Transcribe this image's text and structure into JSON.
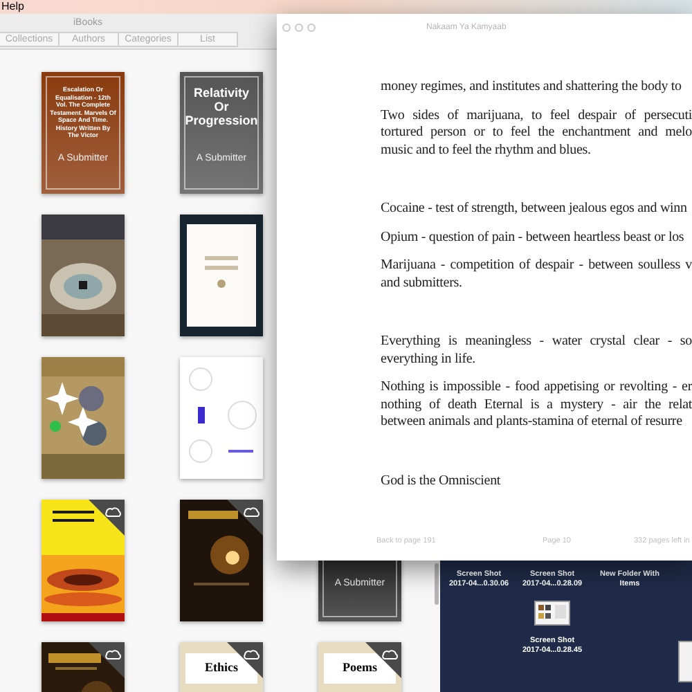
{
  "menu_bar": {
    "items": [
      "Help"
    ]
  },
  "library": {
    "title": "iBooks",
    "tabs": [
      {
        "label": "Collections",
        "selected": false
      },
      {
        "label": "Authors",
        "selected": false
      },
      {
        "label": "Categories",
        "selected": false
      },
      {
        "label": "List",
        "selected": false
      }
    ],
    "rows": [
      {
        "books": [
          {
            "kind": "framed",
            "color": "#8a3a0e",
            "title": "Escalation Or Equalisation - 12th Vol. The Complete Testament. Marvels Of Space And Time. History Written By The Victor",
            "author": "A Submitter",
            "cloud": false
          },
          {
            "kind": "framed",
            "color": "#555555",
            "title": "Relativity Or Progression",
            "author": "A Submitter",
            "cloud": false
          }
        ]
      },
      {
        "books": [
          {
            "kind": "picture",
            "cloud": false
          },
          {
            "kind": "picture",
            "cloud": false
          }
        ]
      },
      {
        "books": [
          {
            "kind": "picture",
            "cloud": false
          },
          {
            "kind": "picture",
            "cloud": false
          }
        ]
      },
      {
        "books": [
          {
            "kind": "picture",
            "cloud": true
          },
          {
            "kind": "picture",
            "cloud": true
          },
          {
            "kind": "framed",
            "color": "#2e2e2e",
            "author": "A Submitter",
            "cloud": false
          }
        ]
      },
      {
        "books": [
          {
            "kind": "picture",
            "cloud": true
          },
          {
            "kind": "label",
            "color": "#e8dcc0",
            "title": "Ethics",
            "cloud": true
          },
          {
            "kind": "label",
            "color": "#e8dcc0",
            "title": "Poems",
            "cloud": true
          }
        ]
      }
    ]
  },
  "reader": {
    "title": "Nakaam Ya Kamyaab",
    "paragraphs": [
      {
        "section_break": false,
        "lines": [
          "money regimes, and institutes and shattering the body to"
        ]
      },
      {
        "section_break": false,
        "lines": [
          "Two sides of marijuana, to feel despair of persecuti",
          "tortured person or to feel the enchantment and melo",
          "music and to feel the rhythm and blues."
        ]
      },
      {
        "section_break": true,
        "lines": [
          "Cocaine - test of strength, between jealous egos and winn"
        ]
      },
      {
        "section_break": false,
        "lines": [
          "Opium - question of pain - between heartless beast or los"
        ]
      },
      {
        "section_break": false,
        "lines": [
          "Marijuana - competition of despair - between soulless v",
          "and submitters."
        ]
      },
      {
        "section_break": true,
        "lines": [
          "Everything is meaningless - water crystal clear - so",
          "everything in life."
        ]
      },
      {
        "section_break": false,
        "lines": [
          "Nothing is impossible - food appetising or revolting - er",
          "nothing of death Eternal is a mystery - air the relat",
          "between animals and plants-stamina of eternal of resurre"
        ]
      },
      {
        "section_break": true,
        "lines": [
          "God is the Omniscient"
        ]
      }
    ],
    "footer": {
      "back_link": "Back to page 191",
      "page": "Page 10",
      "remaining": "332 pages left in"
    }
  },
  "desktop": {
    "items": [
      {
        "label": [
          "Screen Shot",
          "2017-04...0.30.06"
        ],
        "thumbnail": false
      },
      {
        "label": [
          "Screen Shot",
          "2017-04...0.28.09"
        ],
        "thumbnail": false
      },
      {
        "label": [
          "New Folder With",
          "Items"
        ],
        "thumbnail": false
      },
      {
        "label": [
          "Screen Shot",
          "2017-04...0.28.45"
        ],
        "thumbnail": true
      }
    ]
  }
}
